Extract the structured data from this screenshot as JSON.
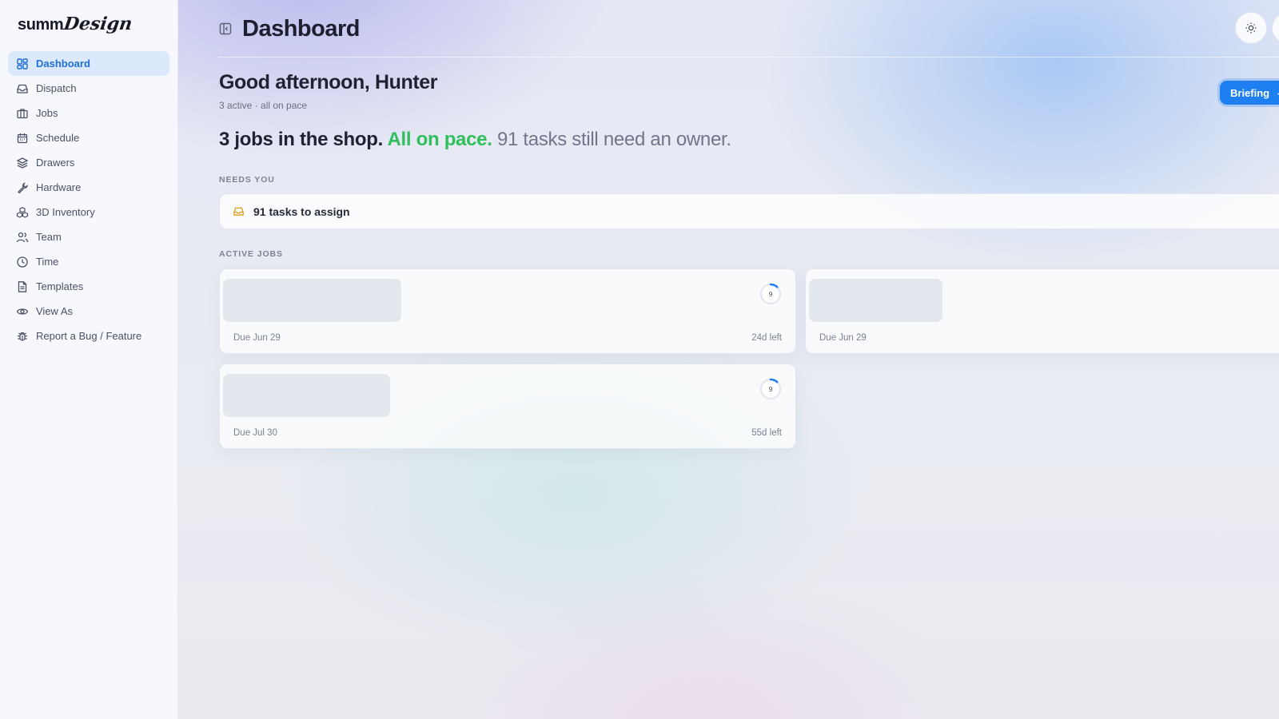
{
  "app": {
    "logo_main": "summ",
    "logo_script": "Design"
  },
  "sidebar": {
    "items": [
      {
        "label": "Dashboard",
        "icon": "dashboard-grid-icon",
        "active": true
      },
      {
        "label": "Dispatch",
        "icon": "inbox-icon"
      },
      {
        "label": "Jobs",
        "icon": "briefcase-icon"
      },
      {
        "label": "Schedule",
        "icon": "calendar-icon"
      },
      {
        "label": "Drawers",
        "icon": "layers-icon"
      },
      {
        "label": "Hardware",
        "icon": "wrench-icon"
      },
      {
        "label": "3D Inventory",
        "icon": "boxes-icon"
      },
      {
        "label": "Team",
        "icon": "users-icon"
      },
      {
        "label": "Time",
        "icon": "clock-icon"
      },
      {
        "label": "Templates",
        "icon": "file-icon"
      },
      {
        "label": "View As",
        "icon": "eye-icon"
      },
      {
        "label": "Report a Bug / Feature",
        "icon": "bug-icon"
      }
    ]
  },
  "header": {
    "title": "Dashboard",
    "briefing_label": "Briefing"
  },
  "greeting": {
    "title": "Good afternoon, Hunter",
    "subline": "3 active · all on pace"
  },
  "headline": {
    "part1": "3 jobs in the shop.",
    "part2": "All on pace.",
    "part3": "91 tasks still need an owner."
  },
  "needs_you": {
    "label": "NEEDS YOU",
    "items": [
      {
        "text": "91 tasks to assign",
        "icon": "inbox-icon"
      }
    ]
  },
  "active_jobs": {
    "label": "ACTIVE JOBS",
    "jobs": [
      {
        "due": "Due Jun 29",
        "left": "24d left",
        "ring_value": "9",
        "progress": 0.12
      },
      {
        "due": "Due Jun 29",
        "left": "",
        "ring_value": "",
        "progress": null
      },
      {
        "due": "Due Jul 30",
        "left": "55d left",
        "ring_value": "9",
        "progress": 0.12
      }
    ]
  },
  "colors": {
    "accent": "#1d7ff0",
    "active_nav_bg": "#dce8fb",
    "on_pace_green": "#2fbf5d",
    "warning_amber": "#e2a224"
  }
}
